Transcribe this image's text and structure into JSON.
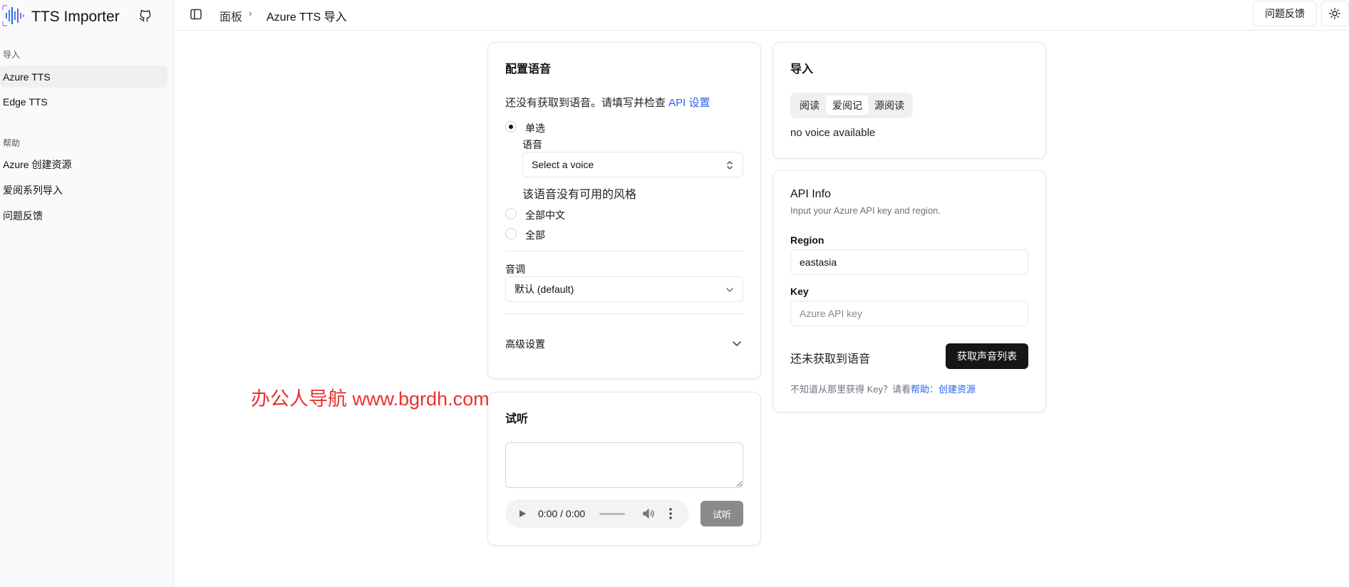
{
  "app": {
    "title": "TTS Importer",
    "accent": "#2563eb"
  },
  "sidebar": {
    "groups": [
      {
        "label": "导入",
        "items": [
          {
            "label": "Azure TTS",
            "active": true
          },
          {
            "label": "Edge TTS",
            "active": false
          }
        ]
      },
      {
        "label": "帮助",
        "items": [
          {
            "label": "Azure 创建资源"
          },
          {
            "label": "爱阅系列导入"
          },
          {
            "label": "问题反馈"
          }
        ]
      }
    ]
  },
  "header": {
    "breadcrumb": [
      "面板",
      "Azure TTS 导入"
    ],
    "feedback_label": "问题反馈"
  },
  "config": {
    "title": "配置语音",
    "notice_prefix": "还没有获取到语音。请填写并检查 ",
    "notice_link": "API 设置",
    "radio_single": "单选",
    "voice_label": "语音",
    "voice_placeholder": "Select a voice",
    "no_style": "该语音没有可用的风格",
    "radio_all_zh": "全部中文",
    "radio_all": "全部",
    "pitch_label": "音调",
    "pitch_value": "默认 (default)",
    "advanced_label": "高级设置"
  },
  "preview": {
    "title": "试听",
    "time": "0:00 / 0:00",
    "button": "试听"
  },
  "import": {
    "title": "导入",
    "tabs": [
      {
        "label": "阅读",
        "active": false
      },
      {
        "label": "爱阅记",
        "active": true
      },
      {
        "label": "源阅读",
        "active": false
      }
    ],
    "empty": "no voice available"
  },
  "api": {
    "title": "API Info",
    "subtitle": "Input your Azure API key and region.",
    "region_label": "Region",
    "region_value": "eastasia",
    "key_label": "Key",
    "key_placeholder": "Azure API key",
    "status": "还未获取到语音",
    "fetch_button": "获取声音列表",
    "help_prefix": "不知道从那里获得 Key？请看",
    "help_link1": "帮助",
    "help_sep": "：",
    "help_link2": "创建资源"
  },
  "watermark": "办公人导航 www.bgrdh.com"
}
